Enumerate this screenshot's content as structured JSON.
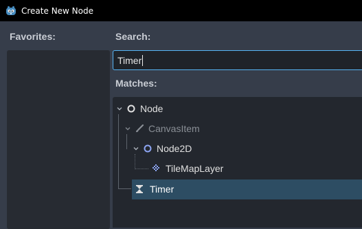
{
  "window": {
    "title": "Create New Node"
  },
  "favorites": {
    "label": "Favorites:"
  },
  "search": {
    "label": "Search:",
    "value": "Timer"
  },
  "matches": {
    "label": "Matches:",
    "items": [
      {
        "label": "Node",
        "icon": "node-circle-icon",
        "dimmed": false,
        "selected": false
      },
      {
        "label": "CanvasItem",
        "icon": "brush-icon",
        "dimmed": true,
        "selected": false
      },
      {
        "label": "Node2D",
        "icon": "node2d-circle-icon",
        "dimmed": false,
        "selected": false
      },
      {
        "label": "TileMapLayer",
        "icon": "tilemap-icon",
        "dimmed": false,
        "selected": false
      },
      {
        "label": "Timer",
        "icon": "hourglass-icon",
        "dimmed": false,
        "selected": true
      }
    ]
  },
  "colors": {
    "accent": "#56b4f5",
    "selection": "#2d4d63",
    "node2d": "#8da5f3",
    "dimmed_text": "#8a8f96"
  }
}
